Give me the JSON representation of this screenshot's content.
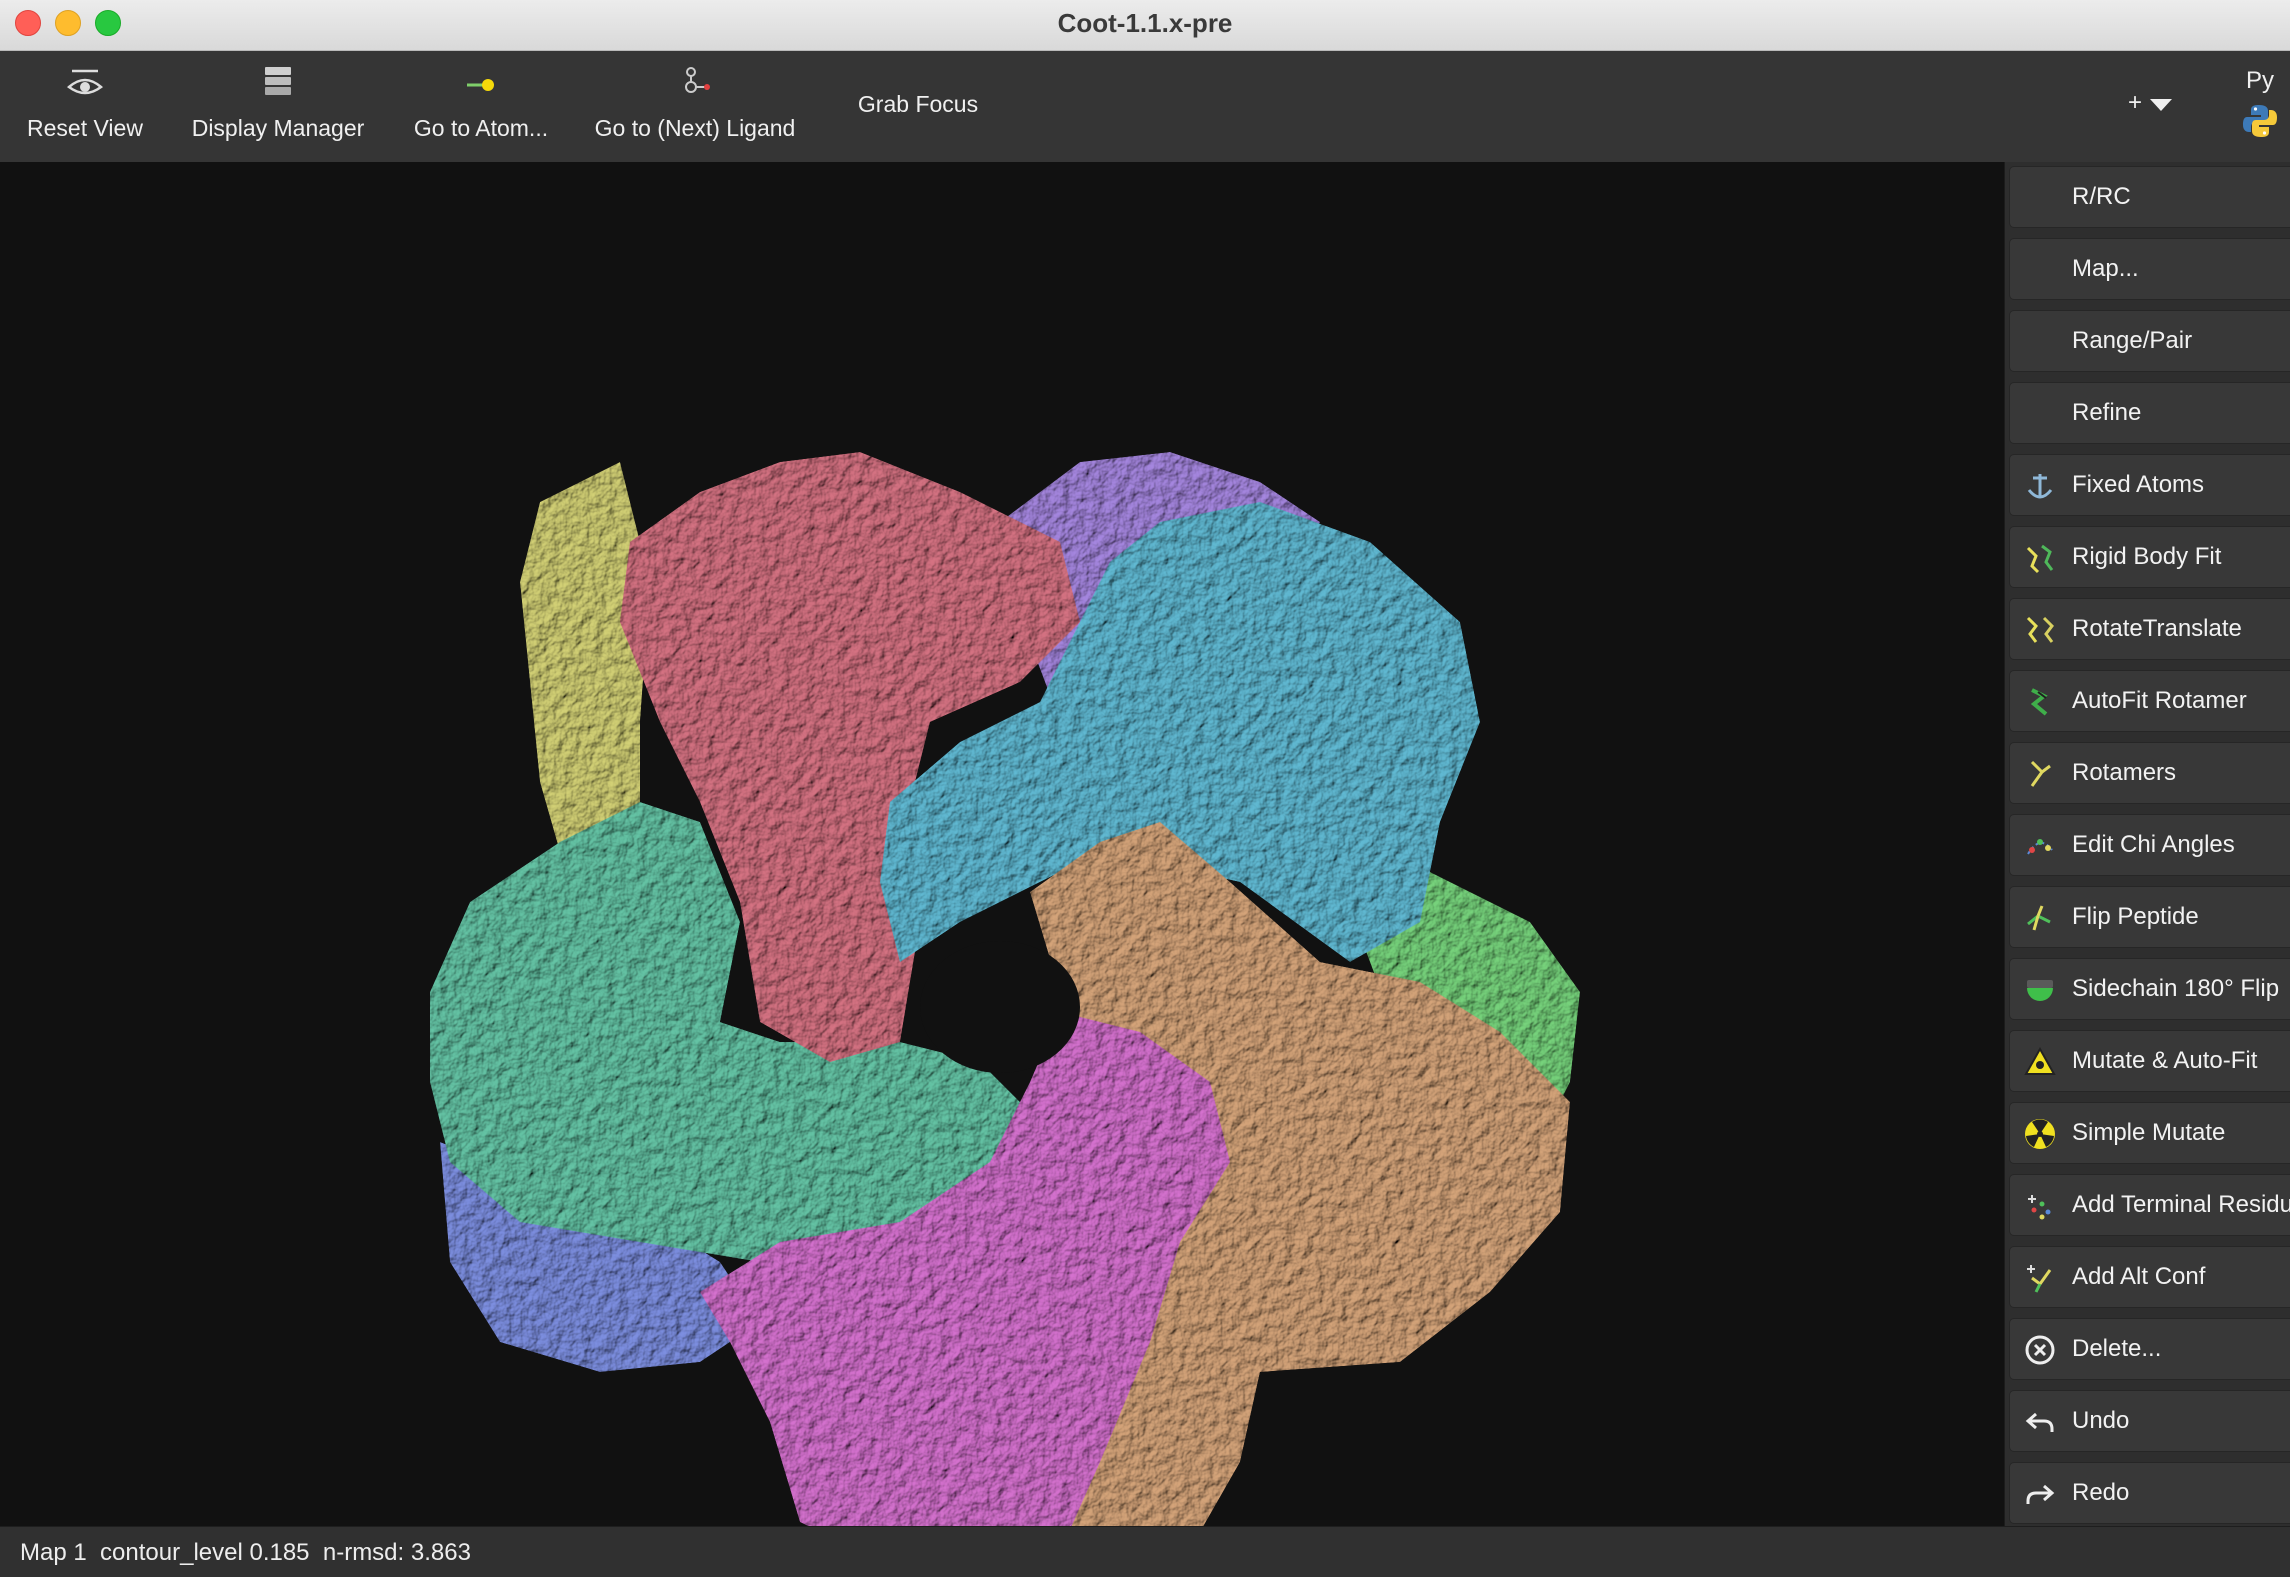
{
  "window": {
    "title": "Coot-1.1.x-pre"
  },
  "toolbar": {
    "reset_view": "Reset View",
    "display_manager": "Display Manager",
    "go_to_atom": "Go to Atom...",
    "go_to_next_ligand": "Go to (Next) Ligand",
    "grab_focus": "Grab Focus",
    "add_menu": "+",
    "python": "Py"
  },
  "side_panel": {
    "items": [
      {
        "label": "R/RC",
        "icon": "none"
      },
      {
        "label": "Map...",
        "icon": "none"
      },
      {
        "label": "Range/Pair",
        "icon": "none"
      },
      {
        "label": "Refine",
        "icon": "none"
      },
      {
        "label": "Fixed Atoms",
        "icon": "anchor-icon"
      },
      {
        "label": "Rigid Body Fit",
        "icon": "rigid-body-icon"
      },
      {
        "label": "RotateTranslate",
        "icon": "rotate-translate-icon"
      },
      {
        "label": "AutoFit Rotamer",
        "icon": "autofit-rotamer-icon"
      },
      {
        "label": "Rotamers",
        "icon": "rotamers-icon"
      },
      {
        "label": "Edit Chi Angles",
        "icon": "chi-angles-icon"
      },
      {
        "label": "Flip Peptide",
        "icon": "flip-peptide-icon"
      },
      {
        "label": "Sidechain 180° Flip",
        "icon": "sidechain-flip-icon"
      },
      {
        "label": "Mutate & Auto-Fit",
        "icon": "mutate-autofit-icon"
      },
      {
        "label": "Simple Mutate",
        "icon": "simple-mutate-icon"
      },
      {
        "label": "Add Terminal Residue",
        "icon": "add-terminal-icon"
      },
      {
        "label": "Add Alt Conf",
        "icon": "alt-conf-icon"
      },
      {
        "label": "Delete...",
        "icon": "delete-icon"
      },
      {
        "label": "Undo",
        "icon": "undo-icon"
      },
      {
        "label": "Redo",
        "icon": "redo-icon"
      }
    ]
  },
  "status": {
    "text": "Map 1  contour_level 0.185  n-rmsd: 3.863"
  },
  "viewport": {
    "background": "#111111",
    "chains": [
      {
        "name": "yellow",
        "color": "#c6c46e"
      },
      {
        "name": "purple",
        "color": "#9b7ed2"
      },
      {
        "name": "blue",
        "color": "#7586d3"
      },
      {
        "name": "green",
        "color": "#6fc674"
      },
      {
        "name": "teal",
        "color": "#5eb89b"
      },
      {
        "name": "red",
        "color": "#c86b7a"
      },
      {
        "name": "cyan",
        "color": "#5aaec6"
      },
      {
        "name": "tan",
        "color": "#c89a72"
      },
      {
        "name": "magenta",
        "color": "#c86ac2"
      }
    ]
  }
}
